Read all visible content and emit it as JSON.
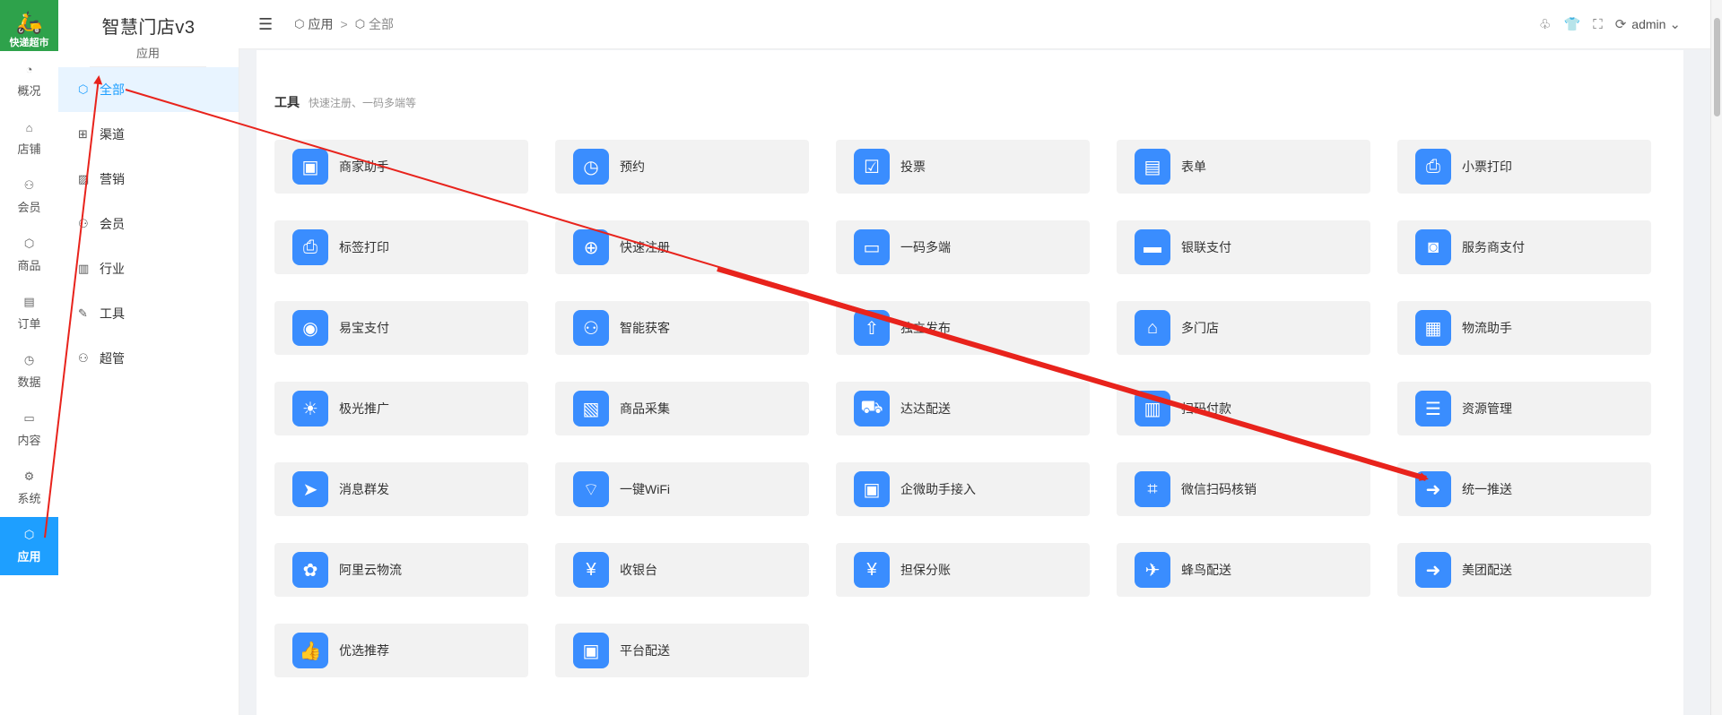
{
  "logo": {
    "glyph": "🛵",
    "text": "快递超市"
  },
  "rail": [
    {
      "label": "概况",
      "icon": "◔",
      "icon_name": "dashboard-icon"
    },
    {
      "label": "店铺",
      "icon": "⌂",
      "icon_name": "shop-icon"
    },
    {
      "label": "会员",
      "icon": "⚇",
      "icon_name": "member-icon"
    },
    {
      "label": "商品",
      "icon": "⬡",
      "icon_name": "goods-icon"
    },
    {
      "label": "订单",
      "icon": "▤",
      "icon_name": "order-icon"
    },
    {
      "label": "数据",
      "icon": "◷",
      "icon_name": "data-icon"
    },
    {
      "label": "内容",
      "icon": "▭",
      "icon_name": "content-icon"
    },
    {
      "label": "系统",
      "icon": "⚙",
      "icon_name": "system-icon"
    },
    {
      "label": "应用",
      "icon": "⬡",
      "icon_name": "app-icon",
      "active": true
    }
  ],
  "subnav": {
    "title": "智慧门店v3",
    "category": "应用",
    "items": [
      {
        "label": "全部",
        "icon": "⬡",
        "icon_name": "cube-icon",
        "active": true
      },
      {
        "label": "渠道",
        "icon": "⊞",
        "icon_name": "channel-icon"
      },
      {
        "label": "营销",
        "icon": "▨",
        "icon_name": "marketing-icon"
      },
      {
        "label": "会员",
        "icon": "⚇",
        "icon_name": "member-icon"
      },
      {
        "label": "行业",
        "icon": "▥",
        "icon_name": "industry-icon"
      },
      {
        "label": "工具",
        "icon": "✎",
        "icon_name": "tool-icon"
      },
      {
        "label": "超管",
        "icon": "⚇",
        "icon_name": "admin-icon"
      }
    ]
  },
  "topbar": {
    "toggle": "☰",
    "crumb_icon": "⬡",
    "crumb_root": "应用",
    "crumb_sep": ">",
    "crumb_current": "全部",
    "user": "admin",
    "icons": [
      {
        "glyph": "♧",
        "name": "bell-icon"
      },
      {
        "glyph": "👕",
        "name": "theme-shirt-icon"
      },
      {
        "glyph": "⛶",
        "name": "fullscreen-icon"
      },
      {
        "glyph": "⟳",
        "name": "refresh-icon"
      }
    ],
    "dropdown_icon": "⌄"
  },
  "section": {
    "title": "工具",
    "desc": "快速注册、一码多端等"
  },
  "apps": [
    {
      "label": "商家助手",
      "icon": "▣",
      "icon_name": "app-phone-icon"
    },
    {
      "label": "预约",
      "icon": "◷",
      "icon_name": "clock-icon"
    },
    {
      "label": "投票",
      "icon": "☑",
      "icon_name": "vote-icon"
    },
    {
      "label": "表单",
      "icon": "▤",
      "icon_name": "form-icon"
    },
    {
      "label": "小票打印",
      "icon": "⎙",
      "icon_name": "receipt-printer-icon"
    },
    {
      "label": "标签打印",
      "icon": "⎙",
      "icon_name": "label-printer-icon"
    },
    {
      "label": "快速注册",
      "icon": "⊕",
      "icon_name": "add-user-icon"
    },
    {
      "label": "一码多端",
      "icon": "▭",
      "icon_name": "multi-device-icon"
    },
    {
      "label": "银联支付",
      "icon": "▬",
      "icon_name": "unionpay-card-icon"
    },
    {
      "label": "服务商支付",
      "icon": "◙",
      "icon_name": "wallet-icon"
    },
    {
      "label": "易宝支付",
      "icon": "◉",
      "icon_name": "yeepay-icon"
    },
    {
      "label": "智能获客",
      "icon": "⚇",
      "icon_name": "customers-icon"
    },
    {
      "label": "独立发布",
      "icon": "⇧",
      "icon_name": "publish-upload-icon"
    },
    {
      "label": "多门店",
      "icon": "⌂",
      "icon_name": "stores-icon"
    },
    {
      "label": "物流助手",
      "icon": "▦",
      "icon_name": "logistics-icon"
    },
    {
      "label": "极光推广",
      "icon": "☀",
      "icon_name": "promotion-icon"
    },
    {
      "label": "商品采集",
      "icon": "▧",
      "icon_name": "collect-icon"
    },
    {
      "label": "达达配送",
      "icon": "⛟",
      "icon_name": "truck-icon"
    },
    {
      "label": "扫码付款",
      "icon": "▥",
      "icon_name": "barcode-scan-icon"
    },
    {
      "label": "资源管理",
      "icon": "☰",
      "icon_name": "resource-icon"
    },
    {
      "label": "消息群发",
      "icon": "➤",
      "icon_name": "paper-plane-icon"
    },
    {
      "label": "一键WiFi",
      "icon": "⌔",
      "icon_name": "wifi-icon"
    },
    {
      "label": "企微助手接入",
      "icon": "▣",
      "icon_name": "folder-icon"
    },
    {
      "label": "微信扫码核销",
      "icon": "⌗",
      "icon_name": "wechat-scan-icon"
    },
    {
      "label": "统一推送",
      "icon": "➜",
      "icon_name": "push-arrow-icon"
    },
    {
      "label": "阿里云物流",
      "icon": "✿",
      "icon_name": "aliyun-icon"
    },
    {
      "label": "收银台",
      "icon": "¥",
      "icon_name": "cashier-icon"
    },
    {
      "label": "担保分账",
      "icon": "¥",
      "icon_name": "guarantee-icon"
    },
    {
      "label": "蜂鸟配送",
      "icon": "✈",
      "icon_name": "hummingbird-icon"
    },
    {
      "label": "美团配送",
      "icon": "➜",
      "icon_name": "meituan-icon"
    },
    {
      "label": "优选推荐",
      "icon": "👍",
      "icon_name": "thumbs-up-icon"
    },
    {
      "label": "平台配送",
      "icon": "▣",
      "icon_name": "platform-delivery-icon"
    }
  ],
  "annotation_color": "#e8231c"
}
